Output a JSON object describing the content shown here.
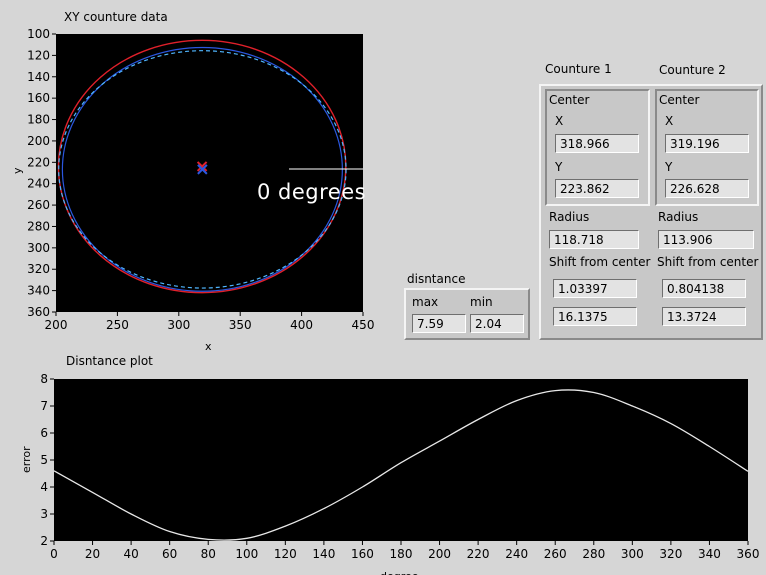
{
  "xy_plot": {
    "title": "XY counture data",
    "xlabel": "x",
    "ylabel": "y",
    "x_ticks": [
      "200",
      "250",
      "300",
      "350",
      "400",
      "450"
    ],
    "y_ticks": [
      "100",
      "120",
      "140",
      "160",
      "180",
      "200",
      "220",
      "240",
      "260",
      "280",
      "300",
      "320",
      "340",
      "360"
    ],
    "overlay_label": "0 degrees",
    "colors": {
      "contour1": "#e0202a",
      "contour2": "#2b57e0",
      "fit": "#4fb6ff",
      "center1": "#e0202a",
      "center2": "#2b57e0"
    }
  },
  "distance_plot": {
    "title": "Disntance plot",
    "xlabel": "degree",
    "ylabel": "error",
    "x_ticks": [
      "0",
      "20",
      "40",
      "60",
      "80",
      "100",
      "120",
      "140",
      "160",
      "180",
      "200",
      "220",
      "240",
      "260",
      "280",
      "300",
      "320",
      "340",
      "360"
    ],
    "y_ticks": [
      "2",
      "3",
      "4",
      "5",
      "6",
      "7",
      "8"
    ]
  },
  "distance_cluster": {
    "title": "disntance",
    "max_label": "max",
    "min_label": "min",
    "max_value": "7.59",
    "min_value": "2.04"
  },
  "contour1": {
    "title": "Counture 1",
    "center_label": "Center",
    "x_label": "X",
    "x_value": "318.966",
    "y_label": "Y",
    "y_value": "223.862",
    "radius_label": "Radius",
    "radius_value": "118.718",
    "shift_label": "Shift from center",
    "shift_value_1": "1.03397",
    "shift_value_2": "16.1375"
  },
  "contour2": {
    "title": "Counture 2",
    "center_label": "Center",
    "x_label": "X",
    "x_value": "319.196",
    "y_label": "Y",
    "y_value": "226.628",
    "radius_label": "Radius",
    "radius_value": "113.906",
    "shift_label": "Shift from center",
    "shift_value_1": "0.804138",
    "shift_value_2": "13.3724"
  },
  "chart_data": [
    {
      "type": "line",
      "title": "XY counture data",
      "xlabel": "x",
      "ylabel": "y",
      "xlim": [
        200,
        450
      ],
      "ylim": [
        360,
        100
      ],
      "y_inverted": true,
      "grid": false,
      "series": [
        {
          "center": [
            319.0,
            223.9
          ],
          "rx": 117,
          "ry": 118
        },
        {
          "center": [
            319.2,
            226.6
          ],
          "rx": 114,
          "ry": 114
        },
        {
          "center": [
            319.2,
            226.6
          ],
          "rx": 117,
          "ry": 111
        }
      ],
      "markers": [
        {
          "x": 318.966,
          "y": 223.862
        },
        {
          "x": 319.196,
          "y": 226.628
        }
      ]
    },
    {
      "type": "line",
      "title": "Disntance plot",
      "xlabel": "degree",
      "ylabel": "error",
      "xlim": [
        0,
        360
      ],
      "ylim": [
        2,
        8
      ],
      "grid": false,
      "x": [
        0,
        20,
        40,
        60,
        80,
        100,
        120,
        140,
        160,
        180,
        200,
        220,
        240,
        260,
        280,
        300,
        320,
        340,
        360
      ],
      "values": [
        4.6,
        3.8,
        3.0,
        2.35,
        2.06,
        2.1,
        2.55,
        3.2,
        4.0,
        4.9,
        5.7,
        6.5,
        7.2,
        7.57,
        7.5,
        7.0,
        6.35,
        5.5,
        4.58
      ]
    }
  ]
}
